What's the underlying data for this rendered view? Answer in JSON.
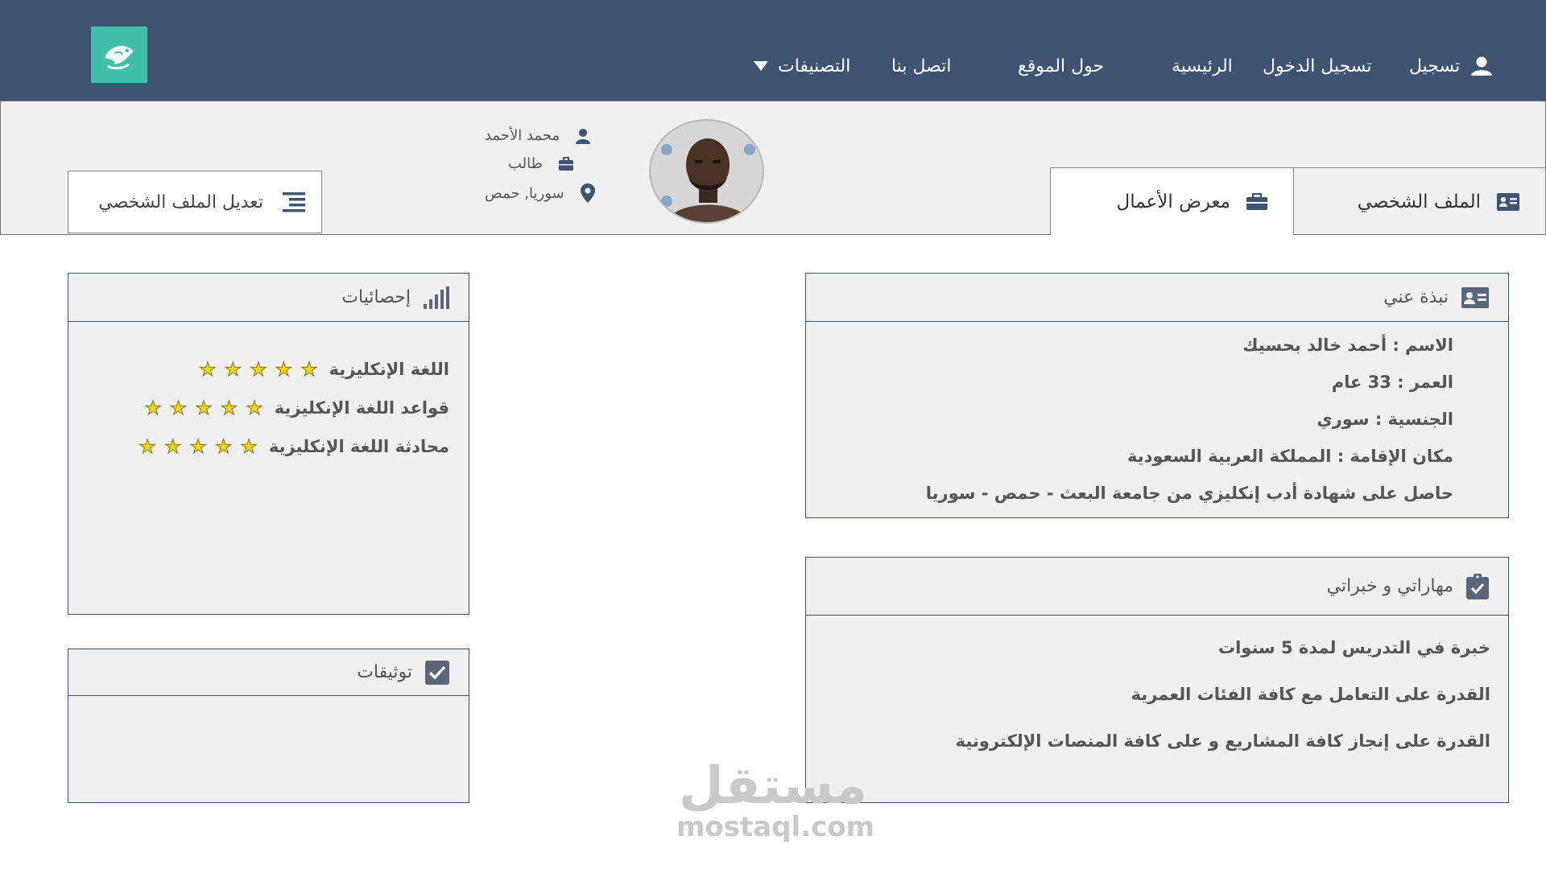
{
  "nav": {
    "register": "تسجيل",
    "login": "تسجيل الدخول",
    "home": "الرئيسية",
    "about_site": "حول الموقع",
    "contact": "اتصل بنا",
    "categories": "التصنيفات"
  },
  "profile": {
    "edit_label": "تعديل الملف الشخصي",
    "name": "محمد الأحمد",
    "role": "طالب",
    "location": "سوريا, حمص",
    "tab_profile": "الملف الشخصي",
    "tab_portfolio": "معرض الأعمال"
  },
  "about": {
    "title": "نبذة عني",
    "lines": [
      "الاسم : أحمد خالد بحسيك",
      "العمر : 33 عام",
      "الجنسية : سوري",
      "مكان الإقامة : المملكة العربية السعودية",
      "حاصل على شهادة أدب إنكليزي من جامعة البعث - حمص - سوريا"
    ]
  },
  "skills": {
    "title": "مهاراتي و خبراتي",
    "lines": [
      "خبرة في التدريس لمدة 5 سنوات",
      "القدرة على التعامل مع كافة الفئات العمرية",
      "القدرة على إنجاز كافة المشاريع و على كافة المنصات الإلكترونية"
    ]
  },
  "stats": {
    "title": "إحصائيات",
    "items": [
      {
        "label": "اللغة الإنكليزية",
        "rating": 5
      },
      {
        "label": "قواعد اللغة الإنكليزية",
        "rating": 5
      },
      {
        "label": "محادثة اللغة الإنكليزية",
        "rating": 5
      }
    ]
  },
  "verifications": {
    "title": "توثيقات"
  },
  "watermark": {
    "arabic": "مستقل",
    "latin": "mostaql.com"
  },
  "colors": {
    "navbar": "#3e5470",
    "logo_bg": "#3fbfa8",
    "panel_bg": "#f0f0f0",
    "star": "#f2d70d"
  },
  "icons": [
    "user-icon",
    "briefcase-icon",
    "map-pin-icon",
    "list-icon",
    "id-card-icon",
    "bar-chart-icon",
    "clipboard-check-icon",
    "checkbox-icon",
    "caret-down-icon",
    "fish-logo-icon"
  ]
}
